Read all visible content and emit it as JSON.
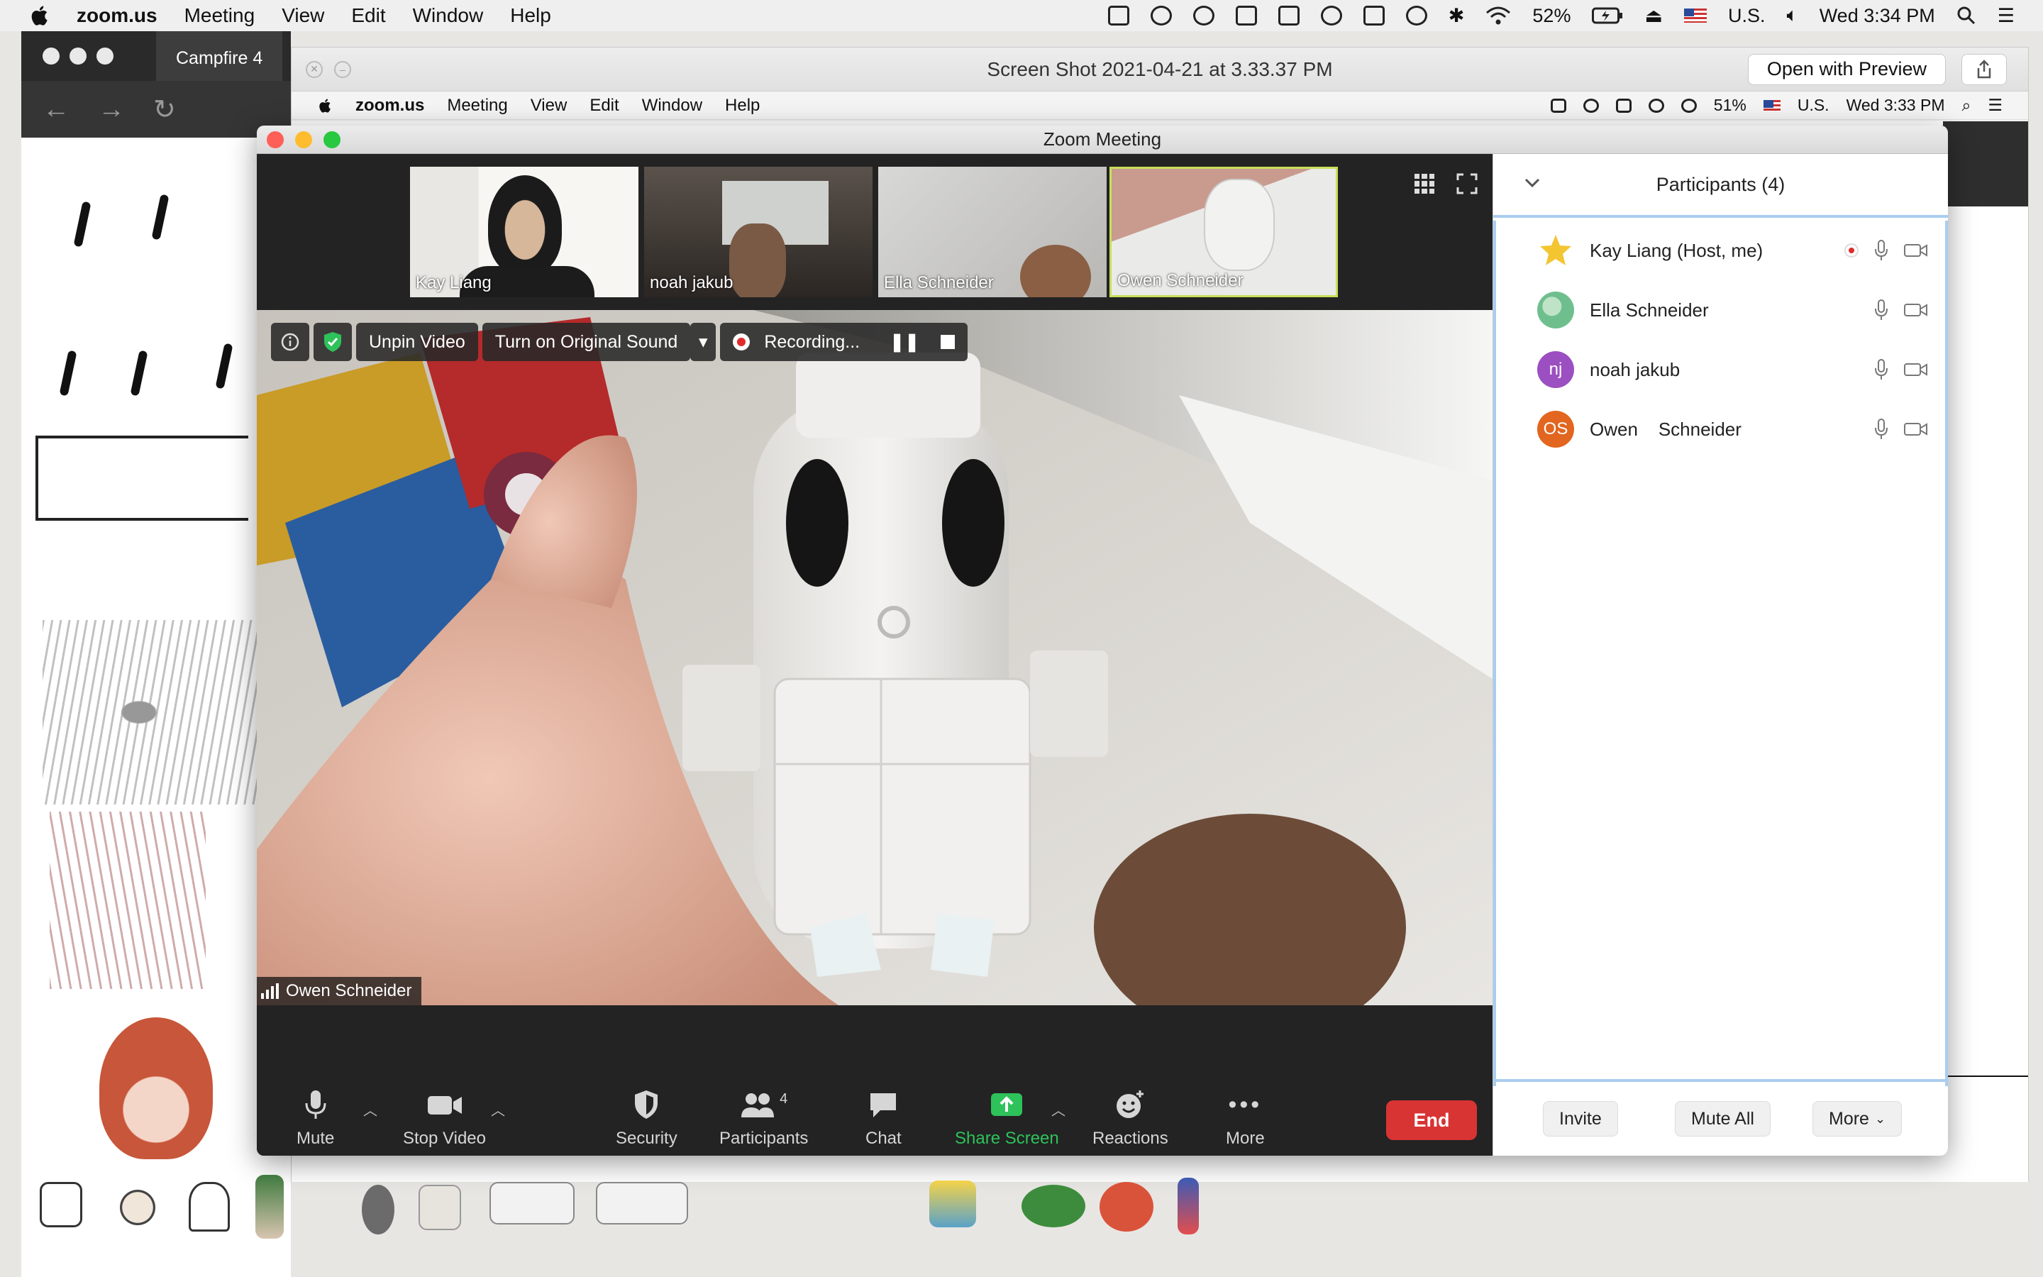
{
  "menubar": {
    "app_name": "zoom.us",
    "items": [
      "Meeting",
      "View",
      "Edit",
      "Window",
      "Help"
    ],
    "battery": "52%",
    "input_source": "U.S.",
    "clock": "Wed 3:34 PM"
  },
  "bg_browser": {
    "tab_title": "Campfire 4"
  },
  "preview_window": {
    "title": "Screen Shot 2021-04-21 at 3.33.37 PM",
    "open_with_button": "Open with Preview"
  },
  "inner_menubar": {
    "app_name": "zoom.us",
    "items": [
      "Meeting",
      "View",
      "Edit",
      "Window",
      "Help"
    ],
    "battery": "51%",
    "input_source": "U.S.",
    "clock": "Wed 3:33 PM"
  },
  "zoom": {
    "window_title": "Zoom Meeting",
    "thumbnails": [
      {
        "name": "Kay Liang"
      },
      {
        "name": "noah jakub"
      },
      {
        "name": "Ella Schneider"
      },
      {
        "name": "Owen    Schneider"
      }
    ],
    "video_toolbar": {
      "unpin": "Unpin Video",
      "original_sound": "Turn on Original Sound",
      "recording": "Recording..."
    },
    "active_speaker": "Owen    Schneider",
    "controls": {
      "mute": "Mute",
      "stop_video": "Stop Video",
      "security": "Security",
      "participants": "Participants",
      "participants_count": "4",
      "chat": "Chat",
      "share_screen": "Share Screen",
      "reactions": "Reactions",
      "more": "More",
      "end": "End"
    },
    "panel": {
      "title": "Participants (4)",
      "participants": [
        {
          "name": "Kay Liang (Host, me)",
          "initials": "",
          "color": "#f5f0d8"
        },
        {
          "name": "Ella Schneider",
          "initials": "",
          "color": "#6fbf8e"
        },
        {
          "name": "noah jakub",
          "initials": "nj",
          "color": "#9b4fc1"
        },
        {
          "name": "Owen    Schneider",
          "initials": "OS",
          "color": "#e2661f"
        }
      ],
      "invite": "Invite",
      "mute_all": "Mute All",
      "more": "More"
    }
  },
  "colors": {
    "end_red": "#d83434",
    "share_green": "#2ec25a",
    "panel_accent": "#a9cdf0"
  }
}
